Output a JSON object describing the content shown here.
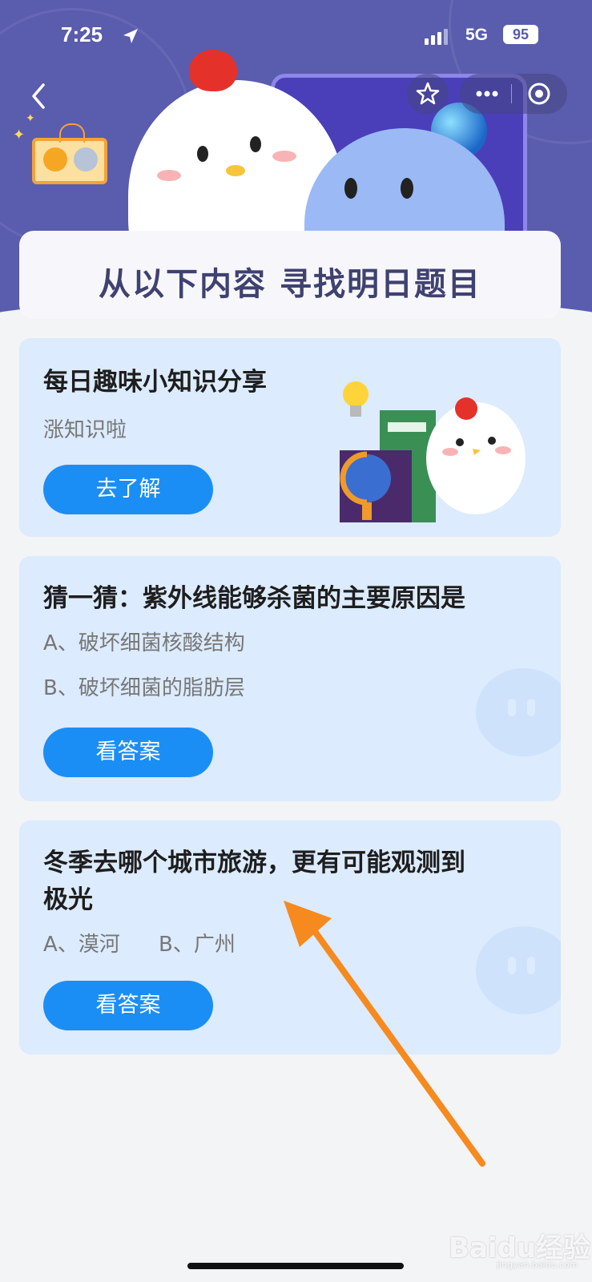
{
  "status_bar": {
    "time": "7:25",
    "network": "5G",
    "battery": "95"
  },
  "header": {
    "banner_title": "从以下内容 寻找明日题目"
  },
  "colors": {
    "header_bg": "#5a5cae",
    "card_bg": "#dcebfd",
    "button": "#1b8ef6",
    "arrow": "#f68a1e"
  },
  "cards": [
    {
      "title": "每日趣味小知识分享",
      "subtitle": "涨知识啦",
      "button": "去了解"
    },
    {
      "title": "猜一猜：紫外线能够杀菌的主要原因是",
      "options": [
        "A、破坏细菌核酸结构",
        "B、破坏细菌的脂肪层"
      ],
      "button": "看答案"
    },
    {
      "title_line1": "冬季去哪个城市旅游，更有可能观测到",
      "title_line2": "极光",
      "options": [
        "A、漠河",
        "B、广州"
      ],
      "button": "看答案"
    }
  ],
  "watermark": {
    "brand": "Baidu经验",
    "url": "jingyan.baidu.com"
  }
}
